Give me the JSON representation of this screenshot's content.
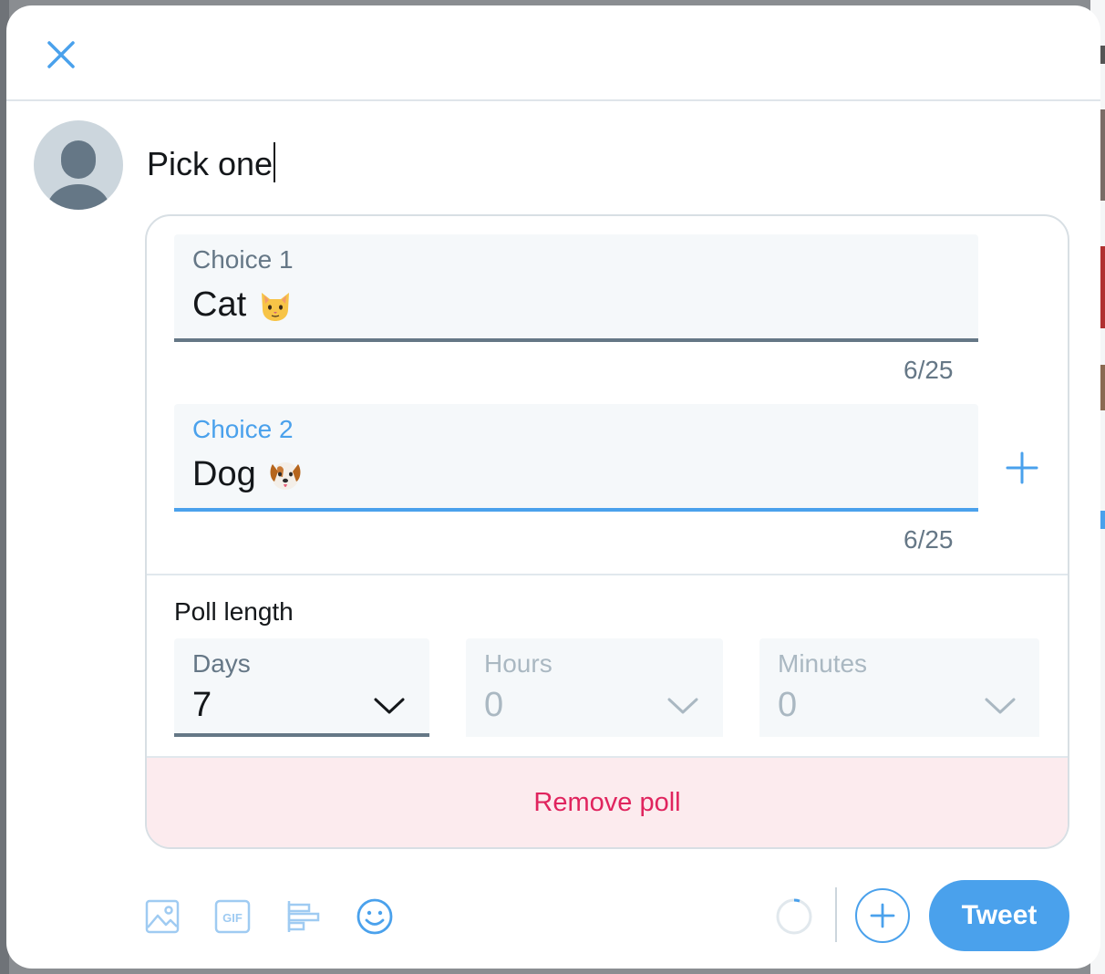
{
  "compose": {
    "text": "Pick one"
  },
  "poll": {
    "choices": [
      {
        "label": "Choice 1",
        "value": "Cat",
        "emoji": "cat-face-emoji",
        "counter": "6/25"
      },
      {
        "label": "Choice 2",
        "value": "Dog",
        "emoji": "dog-face-emoji",
        "counter": "6/25"
      }
    ],
    "length_label": "Poll length",
    "days": {
      "label": "Days",
      "value": "7"
    },
    "hours": {
      "label": "Hours",
      "value": "0"
    },
    "minutes": {
      "label": "Minutes",
      "value": "0"
    },
    "remove_label": "Remove poll"
  },
  "toolbar": {
    "icons": [
      "image-icon",
      "gif-icon",
      "poll-icon",
      "emoji-icon"
    ],
    "tweet_label": "Tweet"
  },
  "colors": {
    "accent": "#4aa1ec",
    "danger": "#e0245e",
    "danger_bg": "#fcebee",
    "muted": "#657786"
  }
}
